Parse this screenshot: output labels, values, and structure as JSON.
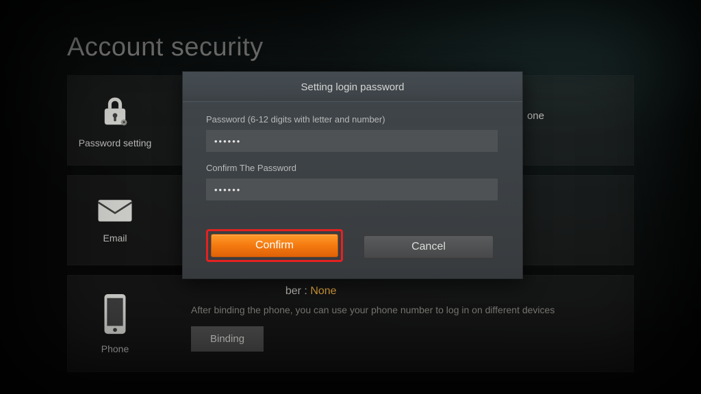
{
  "page": {
    "title": "Account security"
  },
  "sidebar": {
    "password": {
      "label": "Password setting"
    },
    "email": {
      "label": "Email"
    },
    "phone": {
      "label": "Phone"
    }
  },
  "panels": {
    "phone": {
      "header_suffix": "ber :",
      "value": "None",
      "desc": "After binding the phone, you can use your phone number to log in on different devices",
      "btn": "Binding"
    },
    "password_right_fragment": "one"
  },
  "modal": {
    "title": "Setting login password",
    "pwd_label": "Password (6-12 digits with letter and number)",
    "pwd_value": "••••••",
    "confirm_label": "Confirm The Password",
    "confirm_value": "••••••",
    "confirm_btn": "Confirm",
    "cancel_btn": "Cancel"
  }
}
